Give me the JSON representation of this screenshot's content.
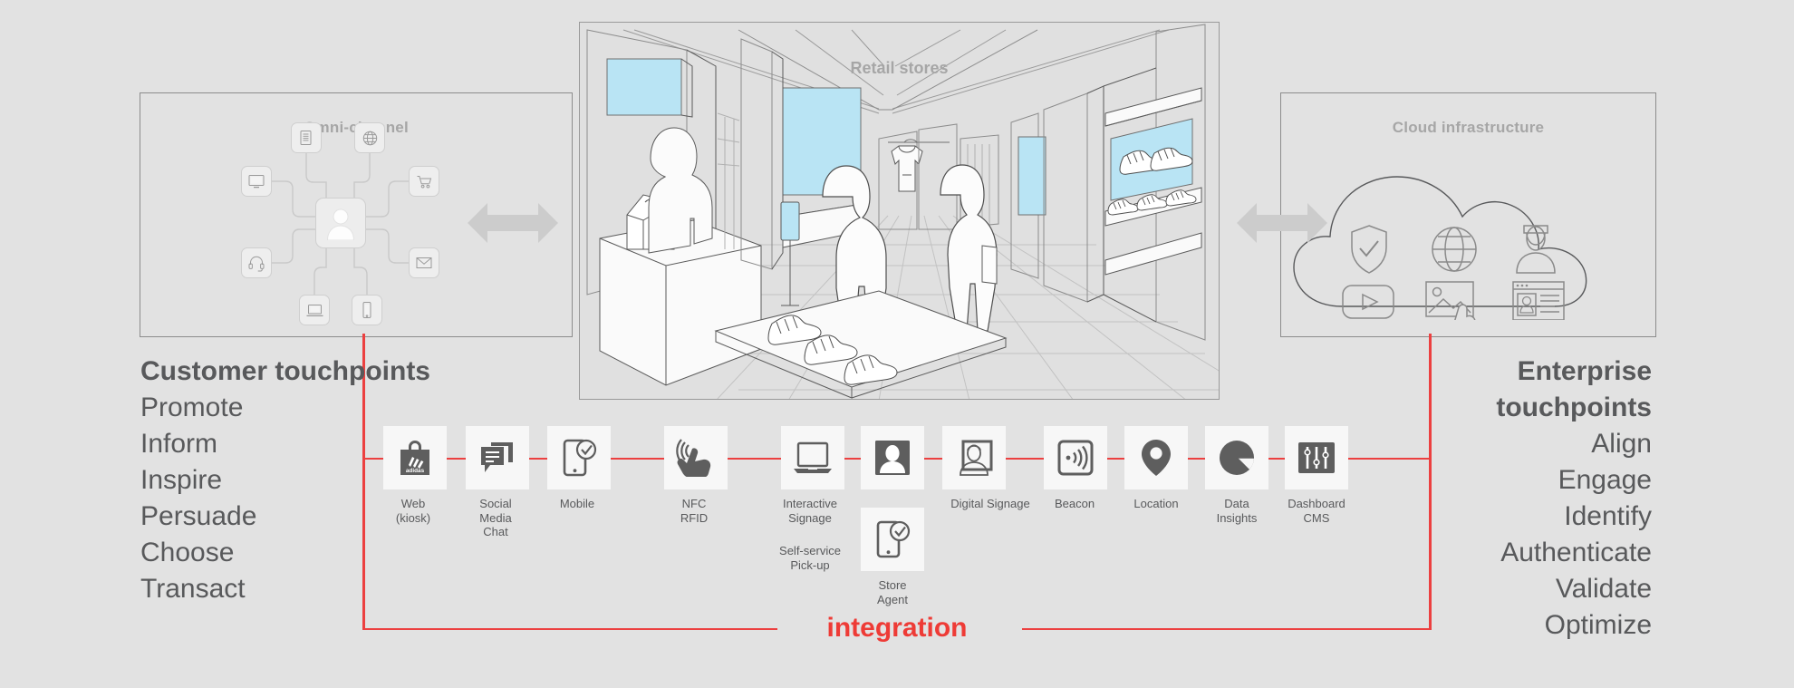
{
  "panels": {
    "omni": {
      "title": "Omni-channel"
    },
    "retail": {
      "title": "Retail stores"
    },
    "cloud": {
      "title": "Cloud infrastructure"
    }
  },
  "omni_nodes": [
    {
      "name": "document-icon",
      "label": "document"
    },
    {
      "name": "globe-icon",
      "label": "globe"
    },
    {
      "name": "monitor-icon",
      "label": "monitor"
    },
    {
      "name": "shopping-cart-icon",
      "label": "shopping cart"
    },
    {
      "name": "headset-icon",
      "label": "headset"
    },
    {
      "name": "envelope-icon",
      "label": "envelope"
    },
    {
      "name": "laptop-icon",
      "label": "laptop"
    },
    {
      "name": "mobile-icon",
      "label": "mobile"
    },
    {
      "name": "customer-avatar-icon",
      "label": "customer"
    }
  ],
  "cloud_nodes": [
    {
      "name": "shield-check-icon",
      "label": "security"
    },
    {
      "name": "globe-icon",
      "label": "global"
    },
    {
      "name": "user-profile-icon",
      "label": "profile"
    },
    {
      "name": "video-play-icon",
      "label": "video"
    },
    {
      "name": "image-gallery-icon",
      "label": "media"
    },
    {
      "name": "id-card-browser-icon",
      "label": "identity"
    }
  ],
  "left_column": {
    "heading": "Customer touchpoints",
    "items": [
      "Promote",
      "Inform",
      "Inspire",
      "Persuade",
      "Choose",
      "Transact"
    ]
  },
  "right_column": {
    "heading_line1": "Enterprise",
    "heading_line2": "touchpoints",
    "items": [
      "Align",
      "Engage",
      "Identify",
      "Authenticate",
      "Validate",
      "Optimize"
    ]
  },
  "integration": {
    "label": "integration"
  },
  "touchpoints": [
    {
      "icon": "adidas-shopping-bag-icon",
      "label": "Web\n(kiosk)"
    },
    {
      "icon": "chat-bubbles-icon",
      "label": "Social\nMedia\nChat"
    },
    {
      "icon": "mobile-check-icon",
      "label": "Mobile"
    },
    {
      "icon": "nfc-tap-hand-icon",
      "label": "NFC\nRFID"
    },
    {
      "icon": "laptop-signage-icon",
      "label": "Interactive\nSignage\n\nSelf-service\nPick-up"
    },
    {
      "icon": "person-avatar-icon",
      "label": "Digital Signage"
    },
    {
      "icon": "digital-signage-icon",
      "label": "Digital Signage"
    },
    {
      "icon": "beacon-signal-icon",
      "label": "Beacon"
    },
    {
      "icon": "location-pin-icon",
      "label": "Location"
    },
    {
      "icon": "pie-chart-icon",
      "label": "Data\nInsights"
    },
    {
      "icon": "sliders-icon",
      "label": "Dashboard\nCMS"
    },
    {
      "icon": "store-agent-mobile-icon",
      "label": "Store\nAgent"
    }
  ],
  "touchpoint_labels": {
    "web": "Web\n(kiosk)",
    "social": "Social\nMedia\nChat",
    "mobile": "Mobile",
    "nfc": "NFC\nRFID",
    "interactive": "Interactive\nSignage",
    "selfservice": "Self-service\nPick-up",
    "digital_signage": "Digital Signage",
    "beacon": "Beacon",
    "location": "Location",
    "data_insights": "Data\nInsights",
    "dashboard_cms": "Dashboard\nCMS",
    "store_agent": "Store\nAgent"
  },
  "colors": {
    "background": "#e2e2e2",
    "accent_red": "#ee3b36",
    "line_red": "#ec4040",
    "text": "#58595b",
    "title_gray": "#a6a6a6",
    "tile_bg": "#f7f7f7",
    "icon_gray": "#5e5e5e",
    "screen_blue": "#b9e4f4"
  }
}
